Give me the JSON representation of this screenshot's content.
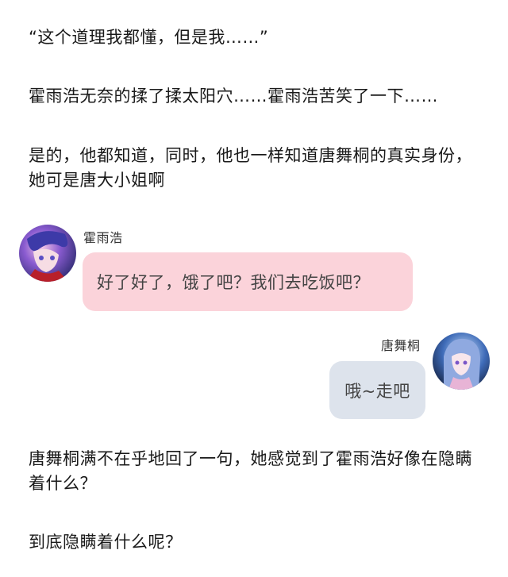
{
  "paragraphs": {
    "p1": "“这个道理我都懂，但是我……”",
    "p2": "霍雨浩无奈的揉了揉太阳穴……霍雨浩苦笑了一下……",
    "p3": "是的，他都知道，同时，他也一样知道唐舞桐的真实身份，她可是唐大小姐啊",
    "p4": "唐舞桐满不在乎地回了一句，她感觉到了霍雨浩好像在隐瞒着什么？",
    "p5": "到底隐瞒着什么呢？"
  },
  "chat": {
    "left": {
      "name": "霍雨浩",
      "message": "好了好了，饿了吧？我们去吃饭吧？",
      "bubble_color": "#fbd3da"
    },
    "right": {
      "name": "唐舞桐",
      "message": "哦~走吧",
      "bubble_color": "#dde3ec"
    }
  }
}
